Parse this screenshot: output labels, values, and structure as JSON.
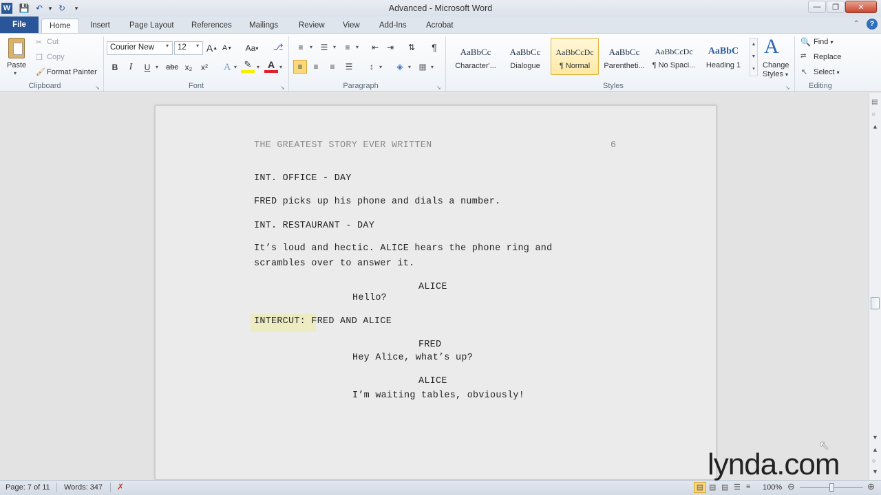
{
  "window": {
    "title": "Advanced - Microsoft Word"
  },
  "tabs": {
    "file": "File",
    "items": [
      "Home",
      "Insert",
      "Page Layout",
      "References",
      "Mailings",
      "Review",
      "View",
      "Add-Ins",
      "Acrobat"
    ]
  },
  "clipboard": {
    "paste": "Paste",
    "cut": "Cut",
    "copy": "Copy",
    "format_painter": "Format Painter",
    "label": "Clipboard"
  },
  "font": {
    "name": "Courier New",
    "size": "12",
    "label": "Font",
    "grow": "A",
    "shrink": "A",
    "change_case": "Aa",
    "bold": "B",
    "italic": "I",
    "underline": "U",
    "strike": "abc",
    "subscript": "x₂",
    "superscript": "x²",
    "font_color": "A"
  },
  "paragraph": {
    "label": "Paragraph",
    "pilcrow": "¶"
  },
  "styles": {
    "label": "Styles",
    "items": [
      {
        "sample": "AaBbCc",
        "name": "Character'..."
      },
      {
        "sample": "AaBbCc",
        "name": "Dialogue"
      },
      {
        "sample": "AaBbCcDc",
        "name": "¶ Normal"
      },
      {
        "sample": "AaBbCc",
        "name": "Parentheti..."
      },
      {
        "sample": "AaBbCcDc",
        "name": "¶ No Spaci..."
      },
      {
        "sample": "AaBbC",
        "name": "Heading 1"
      }
    ],
    "change_styles_line1": "Change",
    "change_styles_line2": "Styles"
  },
  "editing": {
    "label": "Editing",
    "find": "Find",
    "replace": "Replace",
    "select": "Select"
  },
  "document": {
    "header_title": "THE GREATEST STORY EVER WRITTEN",
    "header_page": "6",
    "lines": {
      "l1": "INT. OFFICE - DAY",
      "l2": "FRED picks up his phone and dials a number.",
      "l3": "INT. RESTAURANT - DAY",
      "l4a": "It’s loud and hectic. ALICE hears the phone ring and",
      "l4b": "scrambles over to answer it.",
      "c1": "ALICE",
      "d1": "Hello?",
      "intercut_label": "INTERCUT:",
      "intercut_rest": " FRED AND ALICE",
      "c2": "FRED",
      "d2": "Hey Alice, what’s up?",
      "c3": "ALICE",
      "d3": "I’m waiting tables, obviously!"
    }
  },
  "status": {
    "page": "Page: 7 of 11",
    "words": "Words: 347",
    "zoom": "100%"
  },
  "watermark": "lynda.com",
  "colors": {
    "file_tab": "#2a5699",
    "highlight": "#ecebc2",
    "selected_style": "#fde9a4"
  }
}
